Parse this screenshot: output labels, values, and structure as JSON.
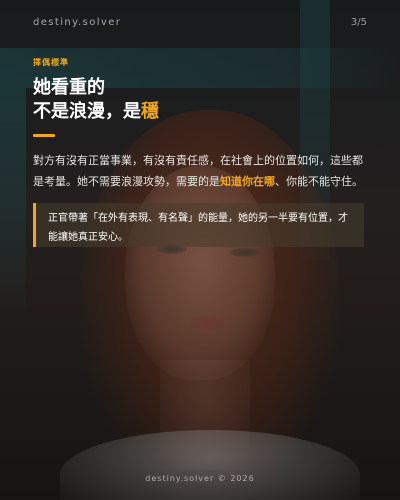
{
  "header": {
    "brand": "destiny.solver",
    "page_indicator": "3/5"
  },
  "section_tag": "擇偶標準",
  "title": {
    "line1": "她看重的",
    "line2_prefix": "不是浪漫，是",
    "line2_highlight": "穩"
  },
  "body": {
    "part1": "對方有沒有正當事業，有沒有責任感，在社會上的位置如何，這些都是考量。她不需要浪漫攻勢，需要的是",
    "highlight": "知道你在哪",
    "part2": "、你能不能守住。"
  },
  "callout": {
    "text": "正官帶著「在外有表現、有名聲」的能量，她的另一半要有位置，才能讓她真正安心。"
  },
  "footer": {
    "text": "destiny.solver © 2026"
  },
  "colors": {
    "accent": "#f2a81d",
    "text": "#ffffff"
  }
}
